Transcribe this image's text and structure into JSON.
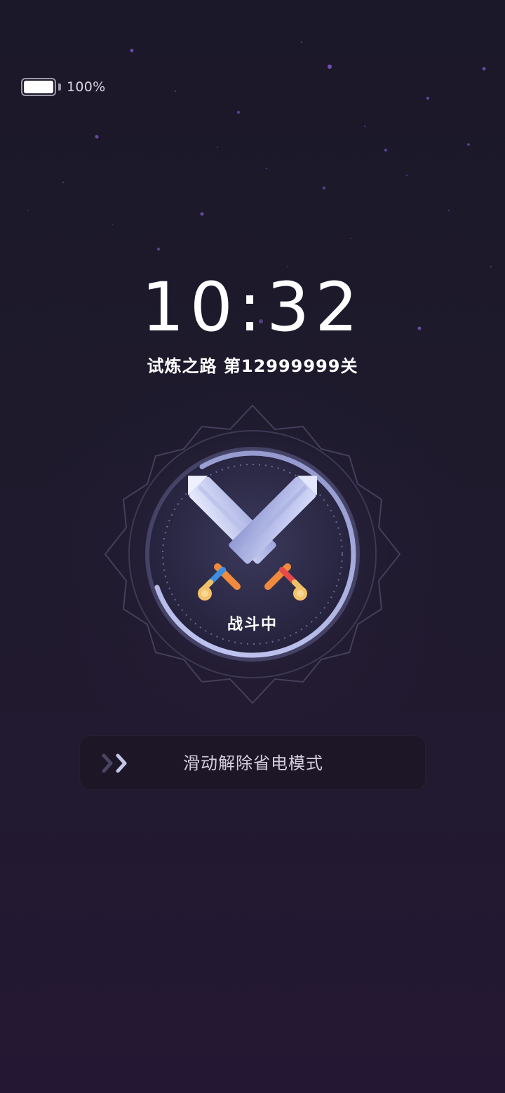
{
  "status": {
    "battery_level": 1.0,
    "battery_text": "100%"
  },
  "lock": {
    "time": "10:32",
    "level_text": "试炼之路 第12999999关",
    "state_label": "战斗中",
    "progress": 0.78
  },
  "slider": {
    "label": "滑动解除省电模式",
    "icon": "double-chevron-right-icon"
  },
  "colors": {
    "background": "#1b1829",
    "accent_ring": "#a3a8dd",
    "star": "#8a5fd0"
  }
}
